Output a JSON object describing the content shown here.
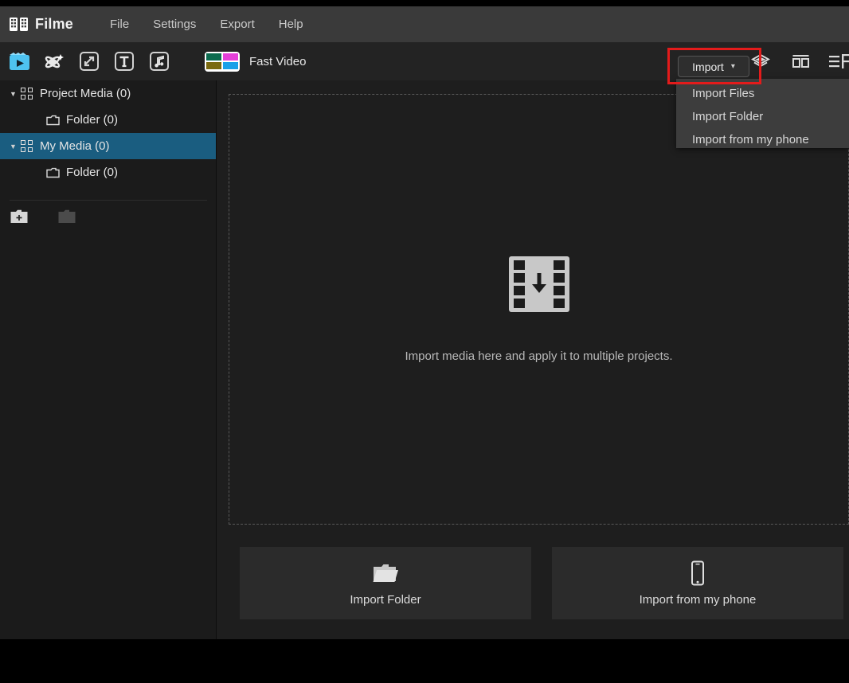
{
  "app": {
    "name": "Filme",
    "logo_icon": "film-strip-logo-icon",
    "accent_blue": "#1a5d80",
    "highlight_red": "#e31b1b"
  },
  "menubar": {
    "items": [
      {
        "label": "File",
        "name": "menu-file"
      },
      {
        "label": "Settings",
        "name": "menu-settings"
      },
      {
        "label": "Export",
        "name": "menu-export"
      },
      {
        "label": "Help",
        "name": "menu-help"
      }
    ]
  },
  "toolbar": {
    "tabs": [
      {
        "icon": "media-clapperboard-icon",
        "active": true
      },
      {
        "icon": "effects-sparkle-icon",
        "active": false
      },
      {
        "icon": "transitions-icon",
        "active": false
      },
      {
        "icon": "text-icon",
        "active": false
      },
      {
        "icon": "music-note-icon",
        "active": false
      }
    ],
    "fast_video": {
      "label": "Fast Video",
      "icon": "fast-video-template-icon",
      "swatches": [
        "#0c6b4f",
        "#e43fd8",
        "#7a6a10",
        "#1aa0e8"
      ]
    },
    "right_icons": [
      {
        "icon": "layers-icon"
      },
      {
        "icon": "grid-view-icon"
      },
      {
        "icon": "list-view-icon"
      }
    ]
  },
  "import": {
    "button_label": "Import",
    "caret_icon": "chevron-down-icon",
    "highlighted": true,
    "menu": [
      {
        "label": "Import Files",
        "name": "menu-import-files"
      },
      {
        "label": "Import Folder",
        "name": "menu-import-folder"
      },
      {
        "label": "Import from my phone",
        "name": "menu-import-from-phone"
      }
    ]
  },
  "sidebar": {
    "tree": [
      {
        "label": "Project Media (0)",
        "icon": "grid-icon",
        "caret": "▼",
        "level": 0,
        "selected": false
      },
      {
        "label": "Folder (0)",
        "icon": "folder-icon",
        "caret": "",
        "level": 1,
        "selected": false
      },
      {
        "label": "My Media (0)",
        "icon": "grid-icon",
        "caret": "▼",
        "level": 0,
        "selected": true
      },
      {
        "label": "Folder (0)",
        "icon": "folder-icon",
        "caret": "",
        "level": 1,
        "selected": false
      }
    ],
    "tools": [
      {
        "icon": "new-folder-icon",
        "enabled": true
      },
      {
        "icon": "folder-icon-disabled",
        "enabled": false
      }
    ]
  },
  "main": {
    "dropzone": {
      "icon": "film-import-arrow-icon",
      "caption": "Import media here and apply it to multiple projects."
    },
    "actions": [
      {
        "label": "Import Folder",
        "icon": "open-folder-icon",
        "name": "import-folder-button"
      },
      {
        "label": "Import from my phone",
        "icon": "phone-icon",
        "name": "import-from-phone-button"
      }
    ]
  }
}
